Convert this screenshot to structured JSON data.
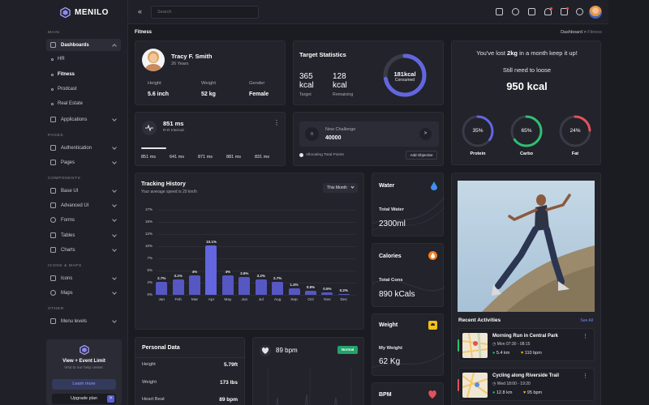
{
  "brand": {
    "name": "MENILO"
  },
  "sidebar": {
    "section_main": "MAIN",
    "section_pages": "PAGES",
    "section_components": "COMPONENTS",
    "section_icons": "ICONS & MAPS",
    "section_other": "OTHER",
    "dashboards": "Dashboards",
    "sub": [
      "HR",
      "Fitness",
      "Prodcast",
      "Real Estate"
    ],
    "applications": "Applications",
    "authentication": "Authentication",
    "pages": "Pages",
    "base_ui": "Base UI",
    "advanced_ui": "Advanced UI",
    "forms": "Forms",
    "tables": "Tables",
    "charts": "Charts",
    "icons": "Icons",
    "maps": "Maps",
    "menu_levels": "Menu levels",
    "promo_title": "View + Event Limit",
    "promo_sub": "Visit to our help center.",
    "learn_more": "Learn more",
    "upgrade": "Upgrade plan",
    "upgrade_arrow": ">"
  },
  "header": {
    "collapse": "«",
    "search_placeholder": "Search"
  },
  "breadcrumb": {
    "title": "Fitness",
    "root": "Dashboard",
    "sep": ">",
    "current": "Fitness"
  },
  "profile": {
    "name": "Tracy F. Smith",
    "age": "26 Years",
    "height_label": "Height",
    "height": "5.6 inch",
    "weight_label": "Weight",
    "weight": "52 kg",
    "gender_label": "Gender",
    "gender": "Female"
  },
  "target": {
    "title": "Target Statistics",
    "target_val": "365 kcal",
    "target_label": "Target",
    "remaining_val": "128 kcal",
    "remaining_label": "Remaining",
    "ring_value": "181kcal",
    "ring_label": "Consumed",
    "ring_progress": 0.72
  },
  "lost": {
    "line_pre": "You've lost",
    "line_bold": "2kg",
    "line_post": "in a month keep it up!",
    "still": "Still need to loose",
    "kcal": "950 kcal",
    "rings": [
      {
        "label": "Protein",
        "value": "35%",
        "pct": 0.35,
        "color": "#6366df"
      },
      {
        "label": "Carbo",
        "value": "65%",
        "pct": 0.65,
        "color": "#2fbf71"
      },
      {
        "label": "Fat",
        "value": "24%",
        "pct": 0.24,
        "color": "#e2525b"
      }
    ]
  },
  "interval": {
    "value": "851 ms",
    "label": "R-R Interval",
    "points": [
      "851 ms",
      "641 ms",
      "871 ms",
      "881 ms",
      "831 ms"
    ],
    "menu": "⋮"
  },
  "challenge": {
    "title": "New Challenge",
    "value": "40000",
    "allocating": "Allocating Total Points",
    "add": "Add Objective",
    "arrow": ">"
  },
  "tracking": {
    "title": "Tracking History",
    "subtitle": "Your average speed is 20 km/h",
    "dropdown": "This Month"
  },
  "chart_data": {
    "type": "bar",
    "title": "Tracking History",
    "categories": [
      "Jan",
      "Feb",
      "Mar",
      "Apr",
      "May",
      "Jun",
      "Jul",
      "Aug",
      "Sep",
      "Oct",
      "Nov",
      "Dec"
    ],
    "values": [
      2.7,
      3.1,
      4,
      10.1,
      4,
      3.6,
      3.2,
      2.7,
      1.4,
      0.9,
      0.5,
      0.2
    ],
    "labels": [
      "2.7%",
      "3.1%",
      "4%",
      "10.1%",
      "4%",
      "3.6%",
      "3.2%",
      "2.7%",
      "1.4%",
      "0.9%",
      "0.5%",
      "0.2%"
    ],
    "yticks": [
      "0%",
      "2%",
      "5%",
      "7%",
      "10%",
      "12%",
      "15%",
      "17%"
    ],
    "ytick_values": [
      0,
      2.5,
      5,
      7.5,
      10,
      12.5,
      15,
      17.5
    ],
    "ylim": [
      0,
      17.5
    ]
  },
  "water": {
    "title": "Water",
    "label": "Total Water",
    "value": "2300ml"
  },
  "calories": {
    "title": "Calories",
    "label": "Total Cons",
    "value": "890 kCals"
  },
  "weight": {
    "title": "Weight",
    "label": "My Weight",
    "value": "62 Kg"
  },
  "bpm": {
    "title": "BPM"
  },
  "personal": {
    "title": "Personal Data",
    "rows": [
      {
        "label": "Height",
        "value": "5.79ft"
      },
      {
        "label": "Weight",
        "value": "173 lbs"
      },
      {
        "label": "Heart Beat",
        "value": "89 bpm"
      }
    ]
  },
  "heart": {
    "value": "89 bpm",
    "badge": "Normal"
  },
  "activities": {
    "title": "Recent Activities",
    "see_all": "See All",
    "items": [
      {
        "title": "Morning Run in Central Park",
        "time": "Mon 07:30 - 08:15",
        "dist": "5.4 km",
        "cal": "110 bpm",
        "color": "#2fbf71",
        "menu": "⋮"
      },
      {
        "title": "Cycling along Riverside Trail",
        "time": "Wed 18:00 - 19:20",
        "dist": "12.8 km",
        "cal": "95 bpm",
        "color": "#e2525b",
        "menu": "⋮"
      }
    ]
  },
  "colors": {
    "accent": "#6366df",
    "bg": "#1b1c22",
    "card": "#22232b"
  }
}
